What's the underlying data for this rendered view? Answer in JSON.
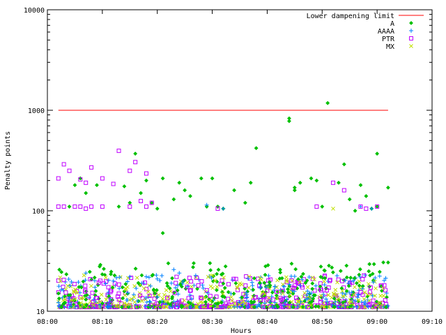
{
  "chart_data": {
    "type": "scatter",
    "xlabel": "Hours",
    "ylabel": "Penalty points",
    "yscale": "log",
    "ylim": [
      10,
      10000
    ],
    "xlim": [
      "08:00",
      "09:10"
    ],
    "x_ticks": [
      "08:00",
      "08:10",
      "08:20",
      "08:30",
      "08:40",
      "08:50",
      "09:00",
      "09:10"
    ],
    "y_ticks": [
      "10",
      "100",
      "1000",
      "10000"
    ],
    "grid": false,
    "legend_position": "top-right",
    "reference_line": {
      "name": "Lower dampening limit",
      "y": 1000,
      "x_start": "08:02",
      "x_end": "09:02",
      "color": "#ff0000"
    },
    "series": [
      {
        "name": "A",
        "marker": "diamond",
        "color": "#00c000",
        "points": [
          [
            "08:03",
            12
          ],
          [
            "08:04",
            110
          ],
          [
            "08:05",
            180
          ],
          [
            "08:06",
            210
          ],
          [
            "08:07",
            150
          ],
          [
            "08:09",
            180
          ],
          [
            "08:10",
            12
          ],
          [
            "08:13",
            110
          ],
          [
            "08:14",
            175
          ],
          [
            "08:15",
            120
          ],
          [
            "08:16",
            370
          ],
          [
            "08:17",
            150
          ],
          [
            "08:18",
            200
          ],
          [
            "08:19",
            120
          ],
          [
            "08:20",
            105
          ],
          [
            "08:21",
            210
          ],
          [
            "08:21",
            60
          ],
          [
            "08:22",
            30
          ],
          [
            "08:23",
            130
          ],
          [
            "08:24",
            190
          ],
          [
            "08:25",
            160
          ],
          [
            "08:26",
            140
          ],
          [
            "08:28",
            210
          ],
          [
            "08:29",
            110
          ],
          [
            "08:30",
            210
          ],
          [
            "08:31",
            110
          ],
          [
            "08:32",
            105
          ],
          [
            "08:34",
            160
          ],
          [
            "08:36",
            120
          ],
          [
            "08:37",
            190
          ],
          [
            "08:38",
            420
          ],
          [
            "08:44",
            780
          ],
          [
            "08:44",
            830
          ],
          [
            "08:45",
            160
          ],
          [
            "08:45",
            170
          ],
          [
            "08:46",
            190
          ],
          [
            "08:48",
            210
          ],
          [
            "08:49",
            200
          ],
          [
            "08:50",
            110
          ],
          [
            "08:51",
            1180
          ],
          [
            "08:53",
            190
          ],
          [
            "08:54",
            290
          ],
          [
            "08:55",
            130
          ],
          [
            "08:56",
            100
          ],
          [
            "08:57",
            180
          ],
          [
            "08:58",
            140
          ],
          [
            "08:59",
            105
          ],
          [
            "09:00",
            370
          ],
          [
            "09:00",
            110
          ],
          [
            "09:02",
            170
          ]
        ]
      },
      {
        "name": "AAAA",
        "marker": "plus",
        "color": "#0080ff",
        "points": [
          [
            "08:07",
            24
          ],
          [
            "08:12",
            20
          ],
          [
            "08:15",
            22
          ],
          [
            "08:20",
            21
          ],
          [
            "08:23",
            26
          ],
          [
            "08:24",
            24
          ],
          [
            "08:29",
            114
          ],
          [
            "08:32",
            105
          ],
          [
            "08:46",
            18
          ],
          [
            "08:57",
            110
          ],
          [
            "08:59",
            105
          ]
        ]
      },
      {
        "name": "PTR",
        "marker": "square",
        "color": "#c000ff",
        "points": [
          [
            "08:02",
            110
          ],
          [
            "08:02",
            210
          ],
          [
            "08:03",
            110
          ],
          [
            "08:03",
            290
          ],
          [
            "08:04",
            250
          ],
          [
            "08:05",
            110
          ],
          [
            "08:06",
            110
          ],
          [
            "08:06",
            205
          ],
          [
            "08:07",
            105
          ],
          [
            "08:07",
            190
          ],
          [
            "08:08",
            110
          ],
          [
            "08:08",
            270
          ],
          [
            "08:10",
            110
          ],
          [
            "08:10",
            210
          ],
          [
            "08:12",
            185
          ],
          [
            "08:13",
            395
          ],
          [
            "08:15",
            250
          ],
          [
            "08:15",
            110
          ],
          [
            "08:16",
            305
          ],
          [
            "08:17",
            125
          ],
          [
            "08:18",
            235
          ],
          [
            "08:18",
            110
          ],
          [
            "08:19",
            120
          ],
          [
            "08:31",
            105
          ],
          [
            "08:49",
            110
          ],
          [
            "08:52",
            190
          ],
          [
            "08:54",
            160
          ],
          [
            "08:57",
            110
          ],
          [
            "08:58",
            105
          ],
          [
            "09:00",
            110
          ],
          [
            "08:13",
            15
          ],
          [
            "08:40",
            16
          ],
          [
            "08:45",
            18
          ]
        ]
      },
      {
        "name": "MX",
        "marker": "cross",
        "color": "#c0e000",
        "points": [
          [
            "08:52",
            105
          ],
          [
            "08:06",
            11
          ],
          [
            "08:14",
            12
          ],
          [
            "08:27",
            11
          ],
          [
            "08:36",
            12
          ],
          [
            "08:44",
            11
          ],
          [
            "08:55",
            12
          ]
        ]
      }
    ]
  }
}
